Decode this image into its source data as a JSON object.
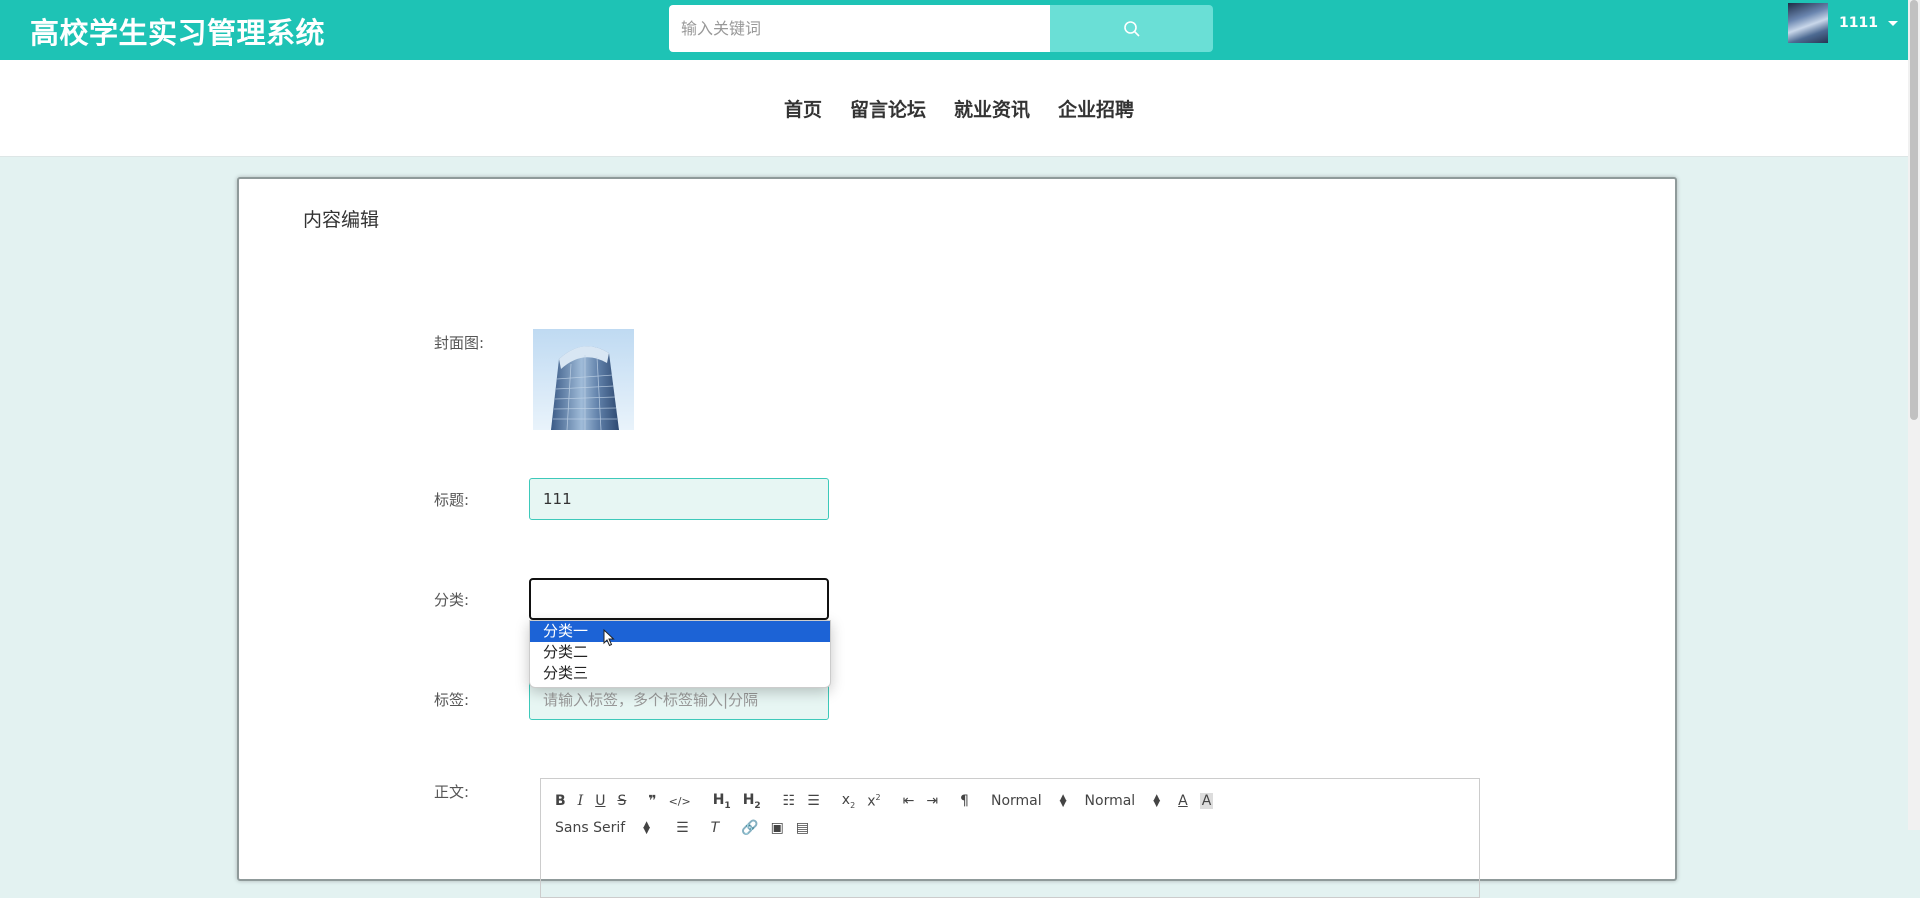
{
  "header": {
    "brand": "高校学生实习管理系统",
    "search_placeholder": "输入关键词",
    "search_icon": "search-icon",
    "username": "1111"
  },
  "nav": {
    "items": [
      {
        "label": "首页"
      },
      {
        "label": "留言论坛"
      },
      {
        "label": "就业资讯"
      },
      {
        "label": "企业招聘"
      }
    ]
  },
  "form": {
    "title": "内容编辑",
    "cover_label": "封面图:",
    "title_label": "标题:",
    "title_value": "111",
    "category_label": "分类:",
    "category_value": "",
    "category_options": [
      "分类一",
      "分类二",
      "分类三"
    ],
    "category_selected_index": 0,
    "tags_label": "标签:",
    "tags_placeholder": "请输入标签，多个标签输入|分隔",
    "body_label": "正文:"
  },
  "editor": {
    "header_select": "Normal",
    "size_select": "Normal",
    "font_select": "Sans Serif"
  },
  "colors": {
    "accent": "#1ec3b5",
    "search_button": "#6adfd6",
    "background": "#e3f2f1",
    "selected_option": "#1c63d6"
  }
}
